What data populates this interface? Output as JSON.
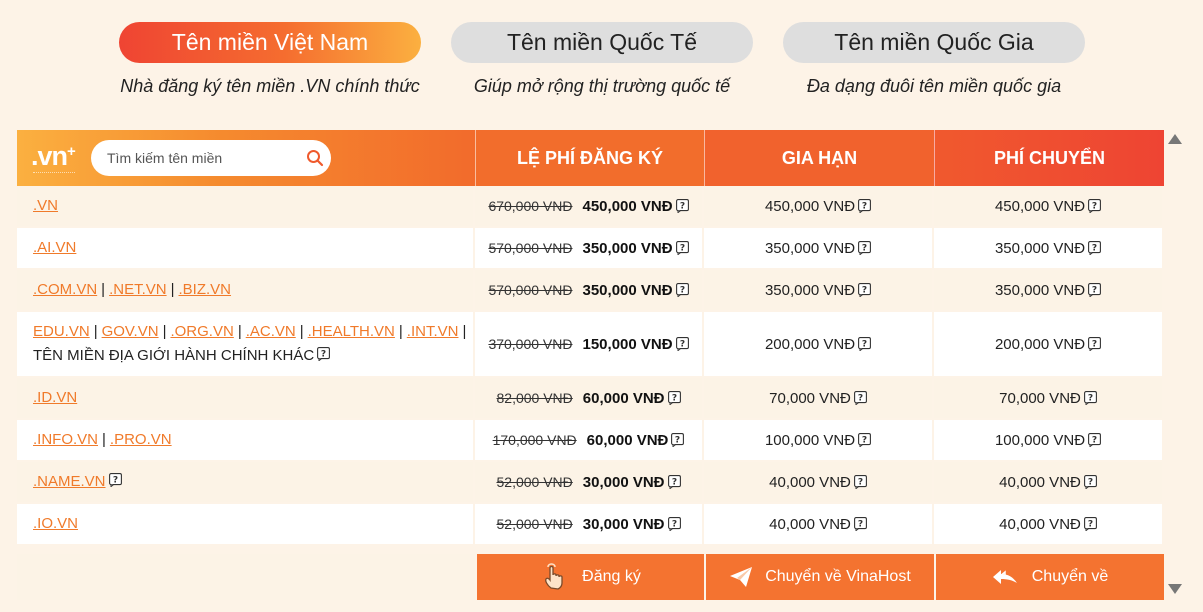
{
  "tabs": [
    {
      "label": "Tên miền Việt Nam",
      "subtitle": "Nhà đăng ký tên miền .VN chính thức",
      "active": true
    },
    {
      "label": "Tên miền Quốc Tế",
      "subtitle": "Giúp mở rộng thị trường quốc tế",
      "active": false
    },
    {
      "label": "Tên miền Quốc Gia",
      "subtitle": "Đa dạng đuôi tên miền quốc gia",
      "active": false
    }
  ],
  "header": {
    "logo_text": ".vn",
    "logo_plus": "+",
    "search_placeholder": "Tìm kiếm tên miền",
    "search_icon": "search-icon",
    "col_register": "LỆ PHÍ ĐĂNG KÝ",
    "col_renew": "GIA HẠN",
    "col_transfer": "PHÍ CHUYỂN"
  },
  "rows": [
    {
      "exts": [
        ".VN"
      ],
      "extra": "",
      "old": "670,000 VNĐ",
      "new": "450,000 VNĐ",
      "renew": "450,000 VNĐ",
      "transfer": "450,000 VNĐ"
    },
    {
      "exts": [
        ".AI.VN"
      ],
      "extra": "",
      "old": "570,000 VNĐ",
      "new": "350,000 VNĐ",
      "renew": "350,000 VNĐ",
      "transfer": "350,000 VNĐ"
    },
    {
      "exts": [
        ".COM.VN",
        ".NET.VN",
        ".BIZ.VN"
      ],
      "extra": "",
      "old": "570,000 VNĐ",
      "new": "350,000 VNĐ",
      "renew": "350,000 VNĐ",
      "transfer": "350,000 VNĐ"
    },
    {
      "exts": [
        "EDU.VN",
        "GOV.VN",
        ".ORG.VN",
        ".AC.VN",
        ".HEALTH.VN",
        ".INT.VN"
      ],
      "extra": "TÊN MIỀN ĐỊA GIỚI HÀNH CHÍNH KHÁC",
      "old": "370,000 VNĐ",
      "new": "150,000 VNĐ",
      "renew": "200,000 VNĐ",
      "transfer": "200,000 VNĐ"
    },
    {
      "exts": [
        ".ID.VN"
      ],
      "extra": "",
      "old": "82,000 VNĐ",
      "new": "60,000 VNĐ",
      "renew": "70,000 VNĐ",
      "transfer": "70,000 VNĐ"
    },
    {
      "exts": [
        ".INFO.VN",
        ".PRO.VN"
      ],
      "extra": "",
      "old": "170,000 VNĐ",
      "new": "60,000 VNĐ",
      "renew": "100,000 VNĐ",
      "transfer": "100,000 VNĐ"
    },
    {
      "exts": [
        ".NAME.VN"
      ],
      "extra": "",
      "old": "52,000 VNĐ",
      "new": "30,000 VNĐ",
      "renew": "40,000 VNĐ",
      "transfer": "40,000 VNĐ",
      "name_help": true
    },
    {
      "exts": [
        ".IO.VN"
      ],
      "extra": "",
      "old": "52,000 VNĐ",
      "new": "30,000 VNĐ",
      "renew": "40,000 VNĐ",
      "transfer": "40,000 VNĐ"
    }
  ],
  "actions": {
    "register_label": "Đăng ký",
    "transfer_in_label": "Chuyển về VinaHost",
    "transfer_back_label": "Chuyển về"
  },
  "colors": {
    "accent": "#f47330",
    "link": "#f07a2a",
    "background": "#fdf3e7"
  }
}
